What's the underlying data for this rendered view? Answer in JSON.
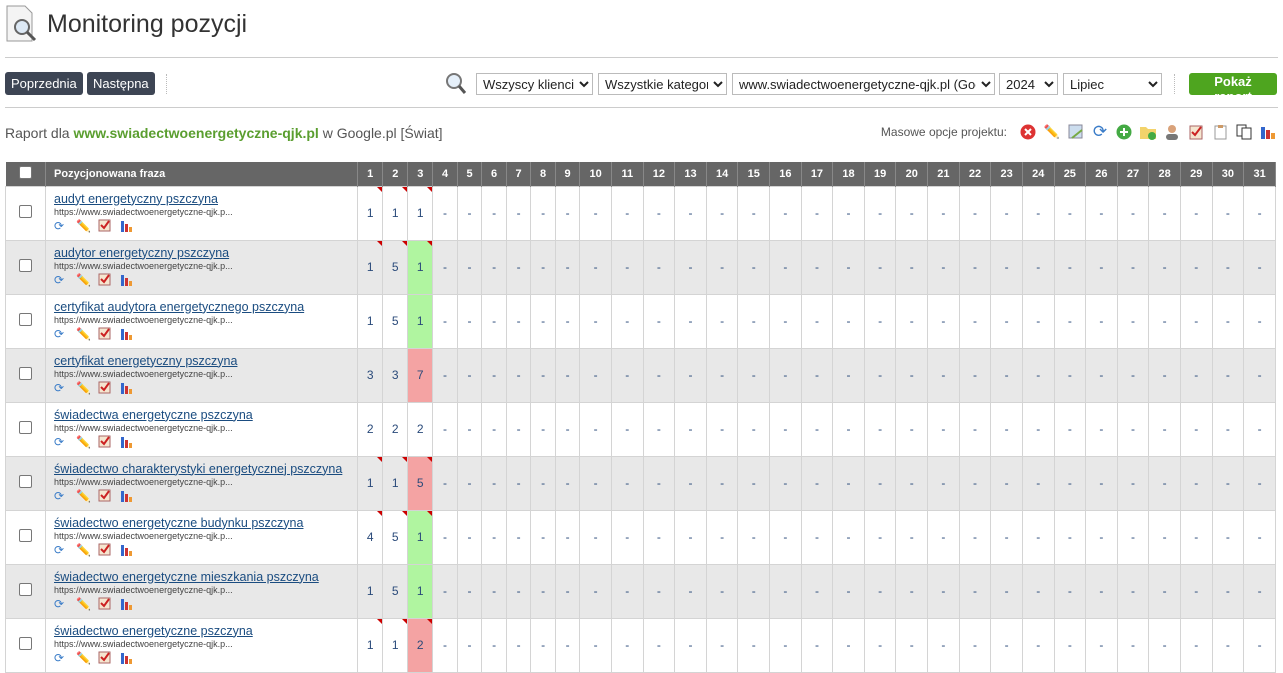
{
  "page": {
    "title": "Monitoring pozycji"
  },
  "toolbar": {
    "prev": "Poprzednia",
    "next": "Następna",
    "client": "Wszyscy klienci",
    "category": "Wszystkie kategorie",
    "project": "www.swiadectwoenergetyczne-qjk.pl (Google",
    "year": "2024",
    "month": "Lipiec",
    "show": "Pokaż raport"
  },
  "report": {
    "prefix": "Raport dla",
    "domain": "www.swiadectwoenergetyczne-qjk.pl",
    "suffix": "w Google.pl [Świat]",
    "mass_label": "Masowe opcje projektu:"
  },
  "table": {
    "phrase_header": "Pozycjonowana fraza",
    "days": [
      "1",
      "2",
      "3",
      "4",
      "5",
      "6",
      "7",
      "8",
      "9",
      "10",
      "11",
      "12",
      "13",
      "14",
      "15",
      "16",
      "17",
      "18",
      "19",
      "20",
      "21",
      "22",
      "23",
      "24",
      "25",
      "26",
      "27",
      "28",
      "29",
      "30",
      "31"
    ],
    "rows": [
      {
        "phrase": "audyt energetyczny pszczyna",
        "url": "https://www.swiadectwoenergetyczne-qjk.p...",
        "pos": [
          "1",
          "1",
          "1"
        ],
        "change": "none",
        "marked": true
      },
      {
        "phrase": "audytor energetyczny pszczyna",
        "url": "https://www.swiadectwoenergetyczne-qjk.p...",
        "pos": [
          "1",
          "5",
          "1"
        ],
        "change": "up",
        "marked": true
      },
      {
        "phrase": "certyfikat audytora energetycznego pszczyna",
        "url": "https://www.swiadectwoenergetyczne-qjk.p...",
        "pos": [
          "1",
          "5",
          "1"
        ],
        "change": "up",
        "marked": false
      },
      {
        "phrase": "certyfikat energetyczny pszczyna",
        "url": "https://www.swiadectwoenergetyczne-qjk.p...",
        "pos": [
          "3",
          "3",
          "7"
        ],
        "change": "down",
        "marked": false
      },
      {
        "phrase": "świadectwa energetyczne pszczyna",
        "url": "https://www.swiadectwoenergetyczne-qjk.p...",
        "pos": [
          "2",
          "2",
          "2"
        ],
        "change": "none",
        "marked": false
      },
      {
        "phrase": "świadectwo charakterystyki energetycznej pszczyna",
        "url": "https://www.swiadectwoenergetyczne-qjk.p...",
        "pos": [
          "1",
          "1",
          "5"
        ],
        "change": "down",
        "marked": true
      },
      {
        "phrase": "świadectwo energetyczne budynku pszczyna",
        "url": "https://www.swiadectwoenergetyczne-qjk.p...",
        "pos": [
          "4",
          "5",
          "1"
        ],
        "change": "up",
        "marked": true
      },
      {
        "phrase": "świadectwo energetyczne mieszkania pszczyna",
        "url": "https://www.swiadectwoenergetyczne-qjk.p...",
        "pos": [
          "1",
          "5",
          "1"
        ],
        "change": "up",
        "marked": false
      },
      {
        "phrase": "świadectwo energetyczne pszczyna",
        "url": "https://www.swiadectwoenergetyczne-qjk.p...",
        "pos": [
          "1",
          "1",
          "2"
        ],
        "change": "down",
        "marked": true
      }
    ],
    "empty": "-"
  }
}
